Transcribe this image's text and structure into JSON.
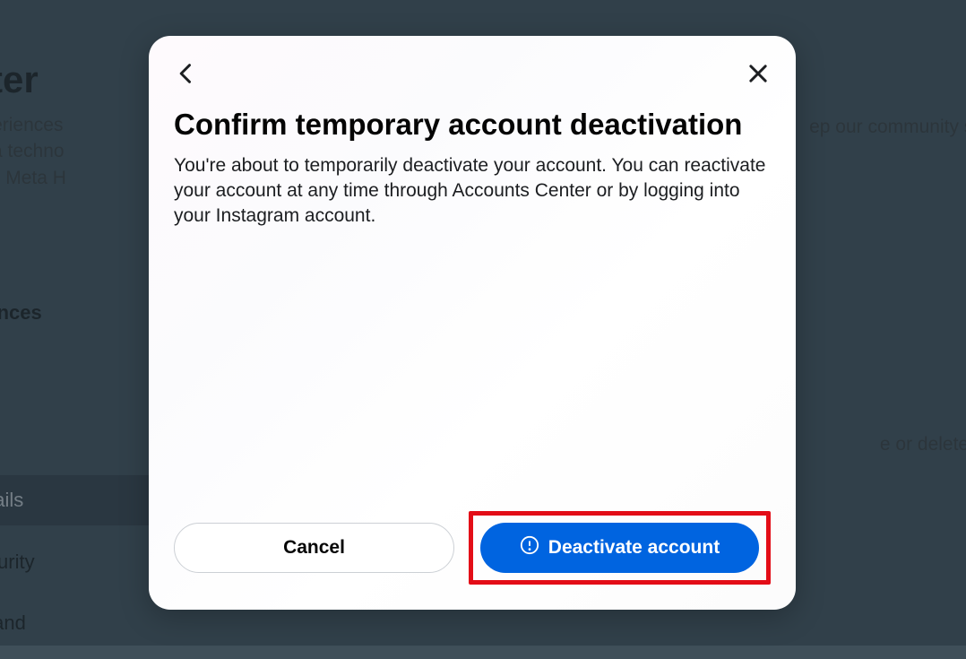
{
  "background": {
    "title_fragment": "enter",
    "desc_line1": "ected experiences",
    "desc_line2": "cross Meta techno",
    "desc_line3": "agram and Meta H",
    "community_fragment": "ep our community sa",
    "experiences_fragment": "d experiences",
    "s_fragment": "s",
    "delete_fragment": "e or delete your acco",
    "details_fragment": "letails",
    "security_fragment": "and security",
    "mation_fragment": "mation and\nns"
  },
  "modal": {
    "title": "Confirm temporary account deactivation",
    "body": "You're about to temporarily deactivate your account. You can reactivate your account at any time through Accounts Center or by logging into your Instagram account.",
    "cancel_label": "Cancel",
    "confirm_label": "Deactivate account"
  }
}
